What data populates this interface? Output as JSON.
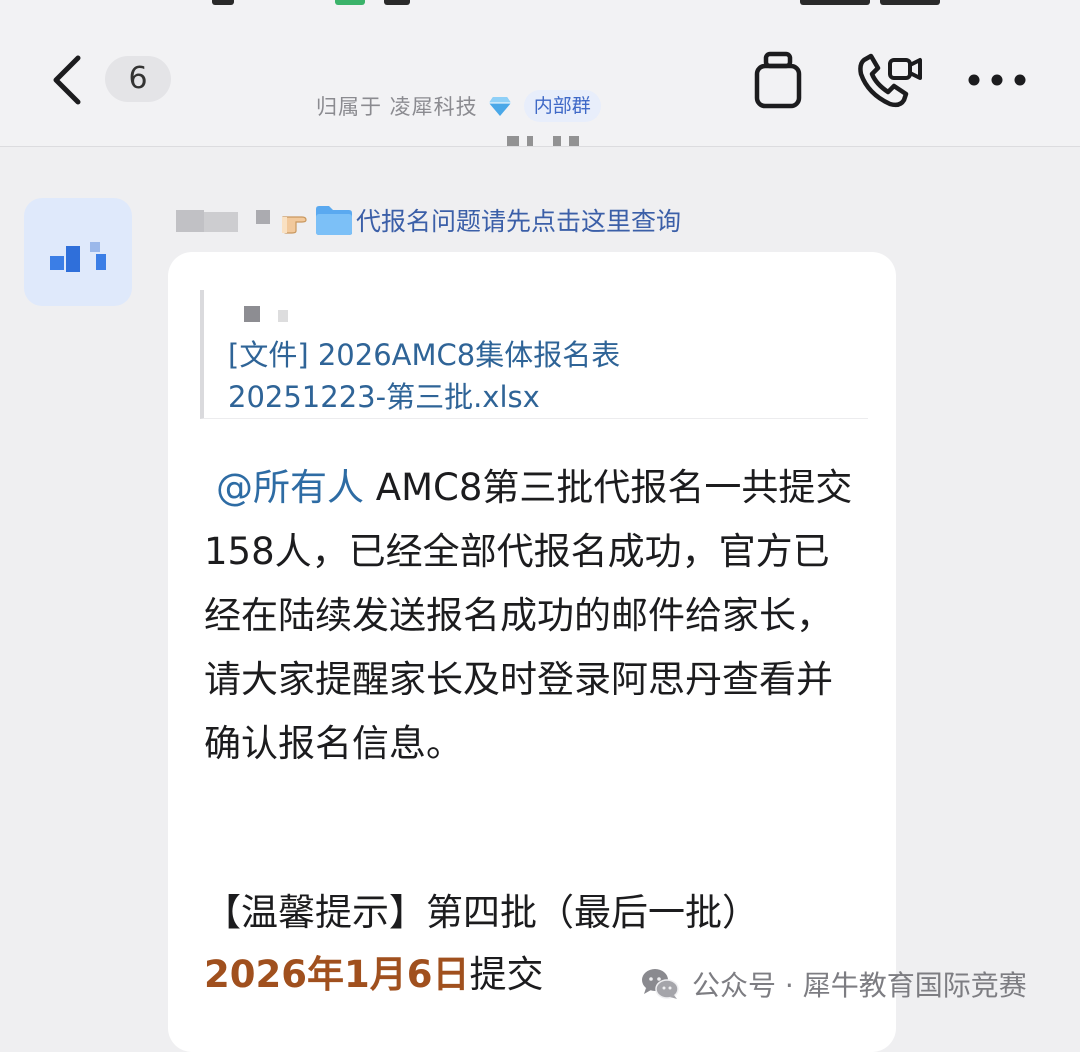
{
  "header": {
    "back_icon": "chevron-left-icon",
    "unread_count": "6",
    "title": "",
    "org_label": "归属于 凌犀科技",
    "org_badge_icon": "diamond-icon",
    "group_tag": "内部群",
    "actions": {
      "copy_icon": "clipboard-icon",
      "call_icon": "phone-video-icon",
      "more_icon": "more-horizontal-icon"
    }
  },
  "message": {
    "sender_note": "代报名问题请先点击这里查询",
    "quote_text": "[文件] 2026AMC8集体报名表\n20251223-第三批.xlsx",
    "mention": "@所有人",
    "body": "AMC8第三批代报名一共提交158人，已经全部代报名成功，官方已经在陆续发送报名成功的邮件给家长，请大家提醒家长及时登录阿思丹查看并确认报名信息。",
    "tip_prefix": "【温馨提示】第四批（最后一批）",
    "tip_date": "2026年1月6日",
    "tip_suffix": "提交"
  },
  "watermark": {
    "text": "公众号 · 犀牛教育国际竞赛"
  },
  "colors": {
    "link_blue": "#2e6ca4",
    "date_highlight": "#a0501e",
    "tag_blue": "#3f69c7"
  }
}
